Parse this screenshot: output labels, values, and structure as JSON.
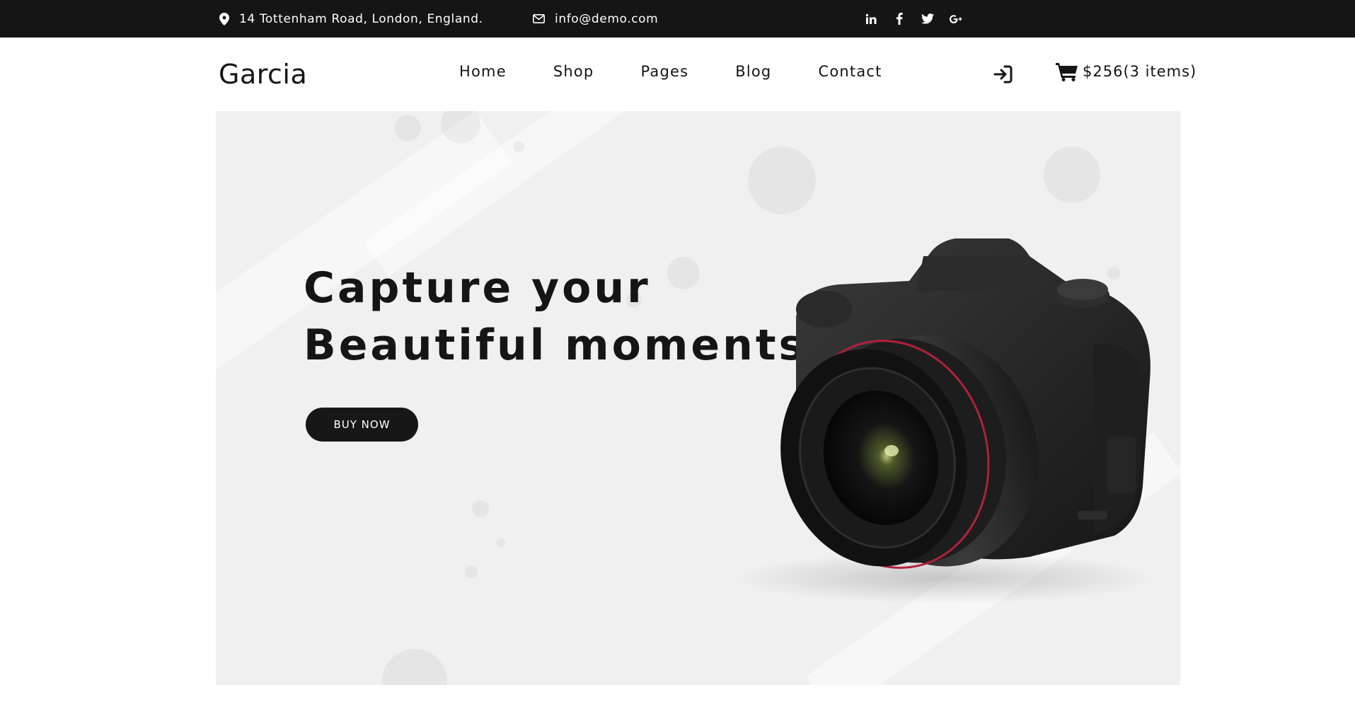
{
  "topbar": {
    "address": "14 Tottenham Road, London, England.",
    "email": "info@demo.com",
    "socials": [
      "linkedin-icon",
      "facebook-icon",
      "twitter-icon",
      "google-plus-icon"
    ]
  },
  "header": {
    "logo": "Garcia",
    "nav": [
      "Home",
      "Shop",
      "Pages",
      "Blog",
      "Contact"
    ],
    "cart_label": "$256(3 items)"
  },
  "hero": {
    "title_line1": "Capture your",
    "title_line2": "Beautiful moments",
    "button_label": "BUY NOW"
  },
  "colors": {
    "topbar_bg": "#151515",
    "hero_bg": "#f0f0f0",
    "button_bg": "#171717",
    "lens_accent": "#b0213a"
  }
}
